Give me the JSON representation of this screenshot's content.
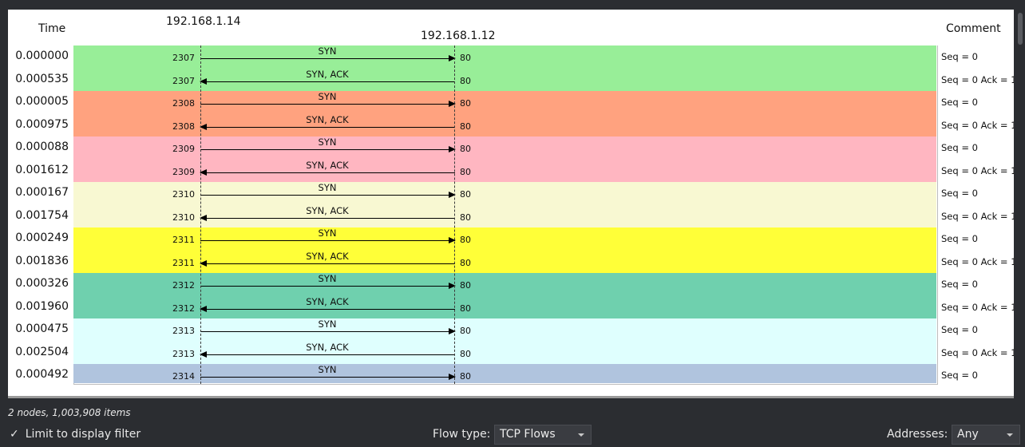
{
  "headers": {
    "time": "Time",
    "host_a": "192.168.1.14",
    "host_b": "192.168.1.12",
    "comment": "Comment"
  },
  "bands": [
    {
      "color": "#98ee98",
      "rows": [
        {
          "time": "0.000000",
          "port_a": "2307",
          "port_b": "80",
          "label": "SYN",
          "direction": "right",
          "comment": "Seq = 0"
        },
        {
          "time": "0.000535",
          "port_a": "2307",
          "port_b": "80",
          "label": "SYN, ACK",
          "direction": "left",
          "comment": "Seq = 0 Ack = 1"
        }
      ]
    },
    {
      "color": "#ffa27f",
      "rows": [
        {
          "time": "0.000005",
          "port_a": "2308",
          "port_b": "80",
          "label": "SYN",
          "direction": "right",
          "comment": "Seq = 0"
        },
        {
          "time": "0.000975",
          "port_a": "2308",
          "port_b": "80",
          "label": "SYN, ACK",
          "direction": "left",
          "comment": "Seq = 0 Ack = 1"
        }
      ]
    },
    {
      "color": "#ffb6c1",
      "rows": [
        {
          "time": "0.000088",
          "port_a": "2309",
          "port_b": "80",
          "label": "SYN",
          "direction": "right",
          "comment": "Seq = 0"
        },
        {
          "time": "0.001612",
          "port_a": "2309",
          "port_b": "80",
          "label": "SYN, ACK",
          "direction": "left",
          "comment": "Seq = 0 Ack = 1"
        }
      ]
    },
    {
      "color": "#f8f8d2",
      "rows": [
        {
          "time": "0.000167",
          "port_a": "2310",
          "port_b": "80",
          "label": "SYN",
          "direction": "right",
          "comment": "Seq = 0"
        },
        {
          "time": "0.001754",
          "port_a": "2310",
          "port_b": "80",
          "label": "SYN, ACK",
          "direction": "left",
          "comment": "Seq = 0 Ack = 1"
        }
      ]
    },
    {
      "color": "#ffff38",
      "rows": [
        {
          "time": "0.000249",
          "port_a": "2311",
          "port_b": "80",
          "label": "SYN",
          "direction": "right",
          "comment": "Seq = 0"
        },
        {
          "time": "0.001836",
          "port_a": "2311",
          "port_b": "80",
          "label": "SYN, ACK",
          "direction": "left",
          "comment": "Seq = 0 Ack = 1"
        }
      ]
    },
    {
      "color": "#6fd0ae",
      "rows": [
        {
          "time": "0.000326",
          "port_a": "2312",
          "port_b": "80",
          "label": "SYN",
          "direction": "right",
          "comment": "Seq = 0"
        },
        {
          "time": "0.001960",
          "port_a": "2312",
          "port_b": "80",
          "label": "SYN, ACK",
          "direction": "left",
          "comment": "Seq = 0 Ack = 1"
        }
      ]
    },
    {
      "color": "#dffffe",
      "rows": [
        {
          "time": "0.000475",
          "port_a": "2313",
          "port_b": "80",
          "label": "SYN",
          "direction": "right",
          "comment": "Seq = 0"
        },
        {
          "time": "0.002504",
          "port_a": "2313",
          "port_b": "80",
          "label": "SYN, ACK",
          "direction": "left",
          "comment": "Seq = 0 Ack = 1"
        }
      ]
    },
    {
      "color": "#b0c4de",
      "rows": [
        {
          "time": "0.000492",
          "port_a": "2314",
          "port_b": "80",
          "label": "SYN",
          "direction": "right",
          "comment": "Seq = 0"
        }
      ]
    }
  ],
  "status": {
    "text": "2 nodes, 1,003,908 items"
  },
  "controls": {
    "limit_check": "✓",
    "limit_label": "Limit to display filter",
    "limit_checked": true,
    "flow_type_label": "Flow type:",
    "flow_type_value": "TCP Flows",
    "addresses_label": "Addresses:",
    "addresses_value": "Any"
  },
  "icons": {
    "checkbox": "check-icon",
    "dropdown": "chevron-down-icon"
  }
}
